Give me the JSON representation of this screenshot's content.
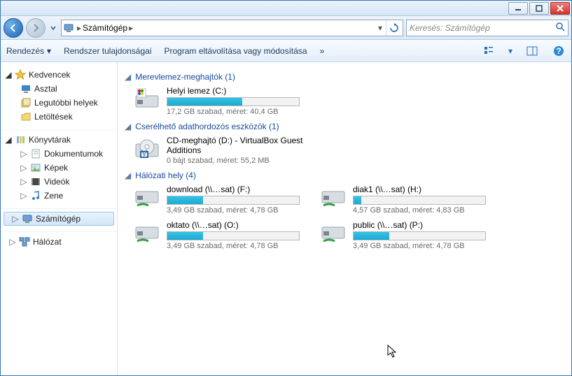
{
  "breadcrumb": {
    "root_icon": "computer",
    "title": "Számítógép"
  },
  "search": {
    "placeholder": "Keresés: Számítógép"
  },
  "toolbar": {
    "organize": "Rendezés",
    "system_props": "Rendszer tulajdonságai",
    "uninstall": "Program eltávolítása vagy módosítása",
    "overflow": "»"
  },
  "sidebar": {
    "favorites": {
      "label": "Kedvencek",
      "items": [
        {
          "label": "Asztal",
          "icon": "desktop"
        },
        {
          "label": "Legutóbbi helyek",
          "icon": "recent"
        },
        {
          "label": "Letöltések",
          "icon": "downloads"
        }
      ]
    },
    "libraries": {
      "label": "Könyvtárak",
      "items": [
        {
          "label": "Dokumentumok",
          "icon": "doc"
        },
        {
          "label": "Képek",
          "icon": "pic"
        },
        {
          "label": "Videók",
          "icon": "vid"
        },
        {
          "label": "Zene",
          "icon": "music"
        }
      ]
    },
    "computer": {
      "label": "Számítógép"
    },
    "network": {
      "label": "Hálózat"
    }
  },
  "groups": {
    "hdd": {
      "label": "Merevlemez-meghajtók (1)"
    },
    "removable": {
      "label": "Cserélhető adathordozós eszközök (1)"
    },
    "network": {
      "label": "Hálózati hely (4)"
    }
  },
  "drives": {
    "c": {
      "name": "Helyi lemez (C:)",
      "sub": "17,2 GB szabad, méret: 40,4 GB",
      "fill": 57
    },
    "d": {
      "name": "CD-meghajtó (D:) - VirtualBox Guest Additions",
      "sub": "0 bájt szabad, méret: 55,2 MB"
    },
    "f": {
      "name": "download (\\\\…sat) (F:)",
      "sub": "3,49 GB szabad, méret: 4,78 GB",
      "fill": 27
    },
    "h": {
      "name": "diak1 (\\\\…sat) (H:)",
      "sub": "4,57 GB szabad, méret: 4,83 GB",
      "fill": 6
    },
    "o": {
      "name": "oktato (\\\\…sat) (O:)",
      "sub": "3,49 GB szabad, méret: 4,78 GB",
      "fill": 27
    },
    "p": {
      "name": "public (\\\\…sat) (P:)",
      "sub": "3,49 GB szabad, méret: 4,78 GB",
      "fill": 27
    }
  }
}
